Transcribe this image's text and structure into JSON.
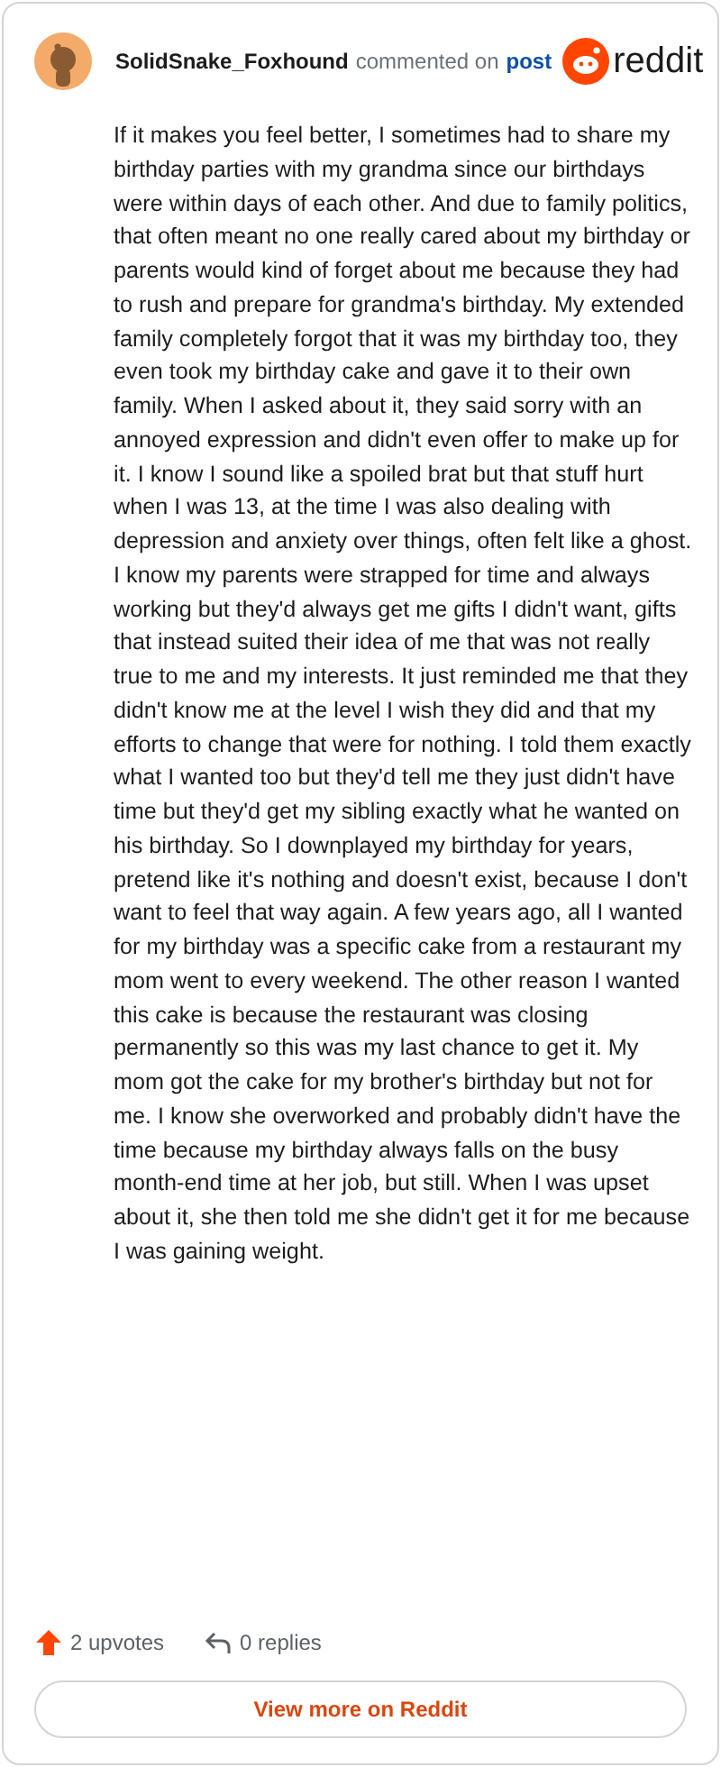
{
  "comment": {
    "author": "SolidSnake_Foxhound",
    "action": "commented on",
    "link": "post",
    "brand": "reddit",
    "body": "If it makes you feel better, I sometimes had to share my birthday parties with my grandma since our birthdays were within days of each other. And due to family politics, that often meant no one really cared about my birthday or parents would kind of forget about me because they had to rush and prepare for grandma's birthday. My extended family completely forgot that it was my birthday too, they even took my birthday cake and gave it to their own family. When I asked about it, they said sorry with an annoyed expression and didn't even offer to make up for it. I know I sound like a spoiled brat but that stuff hurt when I was 13, at the time I was also dealing with depression and anxiety over things, often felt like a ghost. I know my parents were strapped for time and always working but they'd always get me gifts I didn't want, gifts that instead suited their idea of me that was not really true to me and my interests. It just reminded me that they didn't know me at the level I wish they did and that my efforts to change that were for nothing. I told them exactly what I wanted too but they'd tell me they just didn't have time but they'd get my sibling exactly what he wanted on his birthday. So I downplayed my birthday for years, pretend like it's nothing and doesn't exist, because I don't want to feel that way again. A few years ago, all I wanted for my birthday was a specific cake from a restaurant my mom went to every weekend. The other reason I wanted this cake is because the restaurant was closing permanently so this was my last chance to get it. My mom got the cake for my brother's birthday but not for me. I know she overworked and probably didn't have the time because my birthday always falls on the busy month-end time at her job, but still. When I was upset about it, she then told me she didn't get it for me because I was gaining weight.",
    "upvotes": "2 upvotes",
    "replies": "0 replies"
  },
  "button": "View more on Reddit"
}
